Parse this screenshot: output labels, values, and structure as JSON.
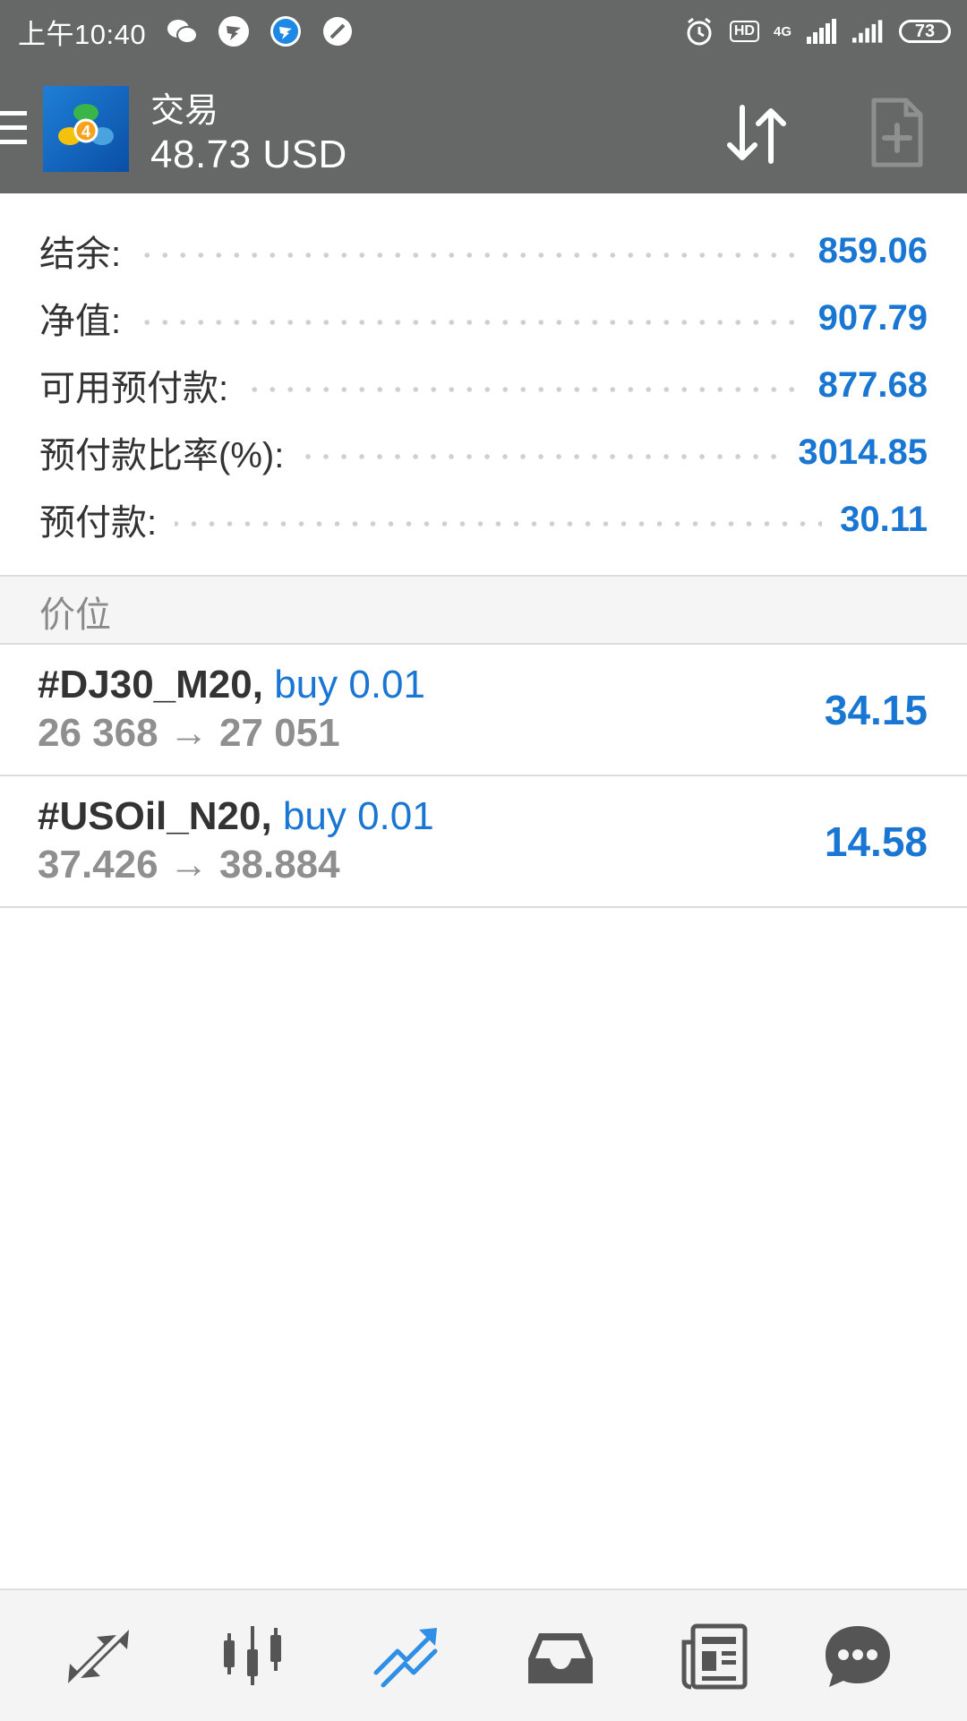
{
  "status_bar": {
    "time": "上午10:40",
    "network": "4G",
    "hd": "HD",
    "battery": "73"
  },
  "header": {
    "title": "交易",
    "balance_summary": "48.73 USD"
  },
  "account": {
    "rows": [
      {
        "label": "结余:",
        "value": "859.06"
      },
      {
        "label": "净值:",
        "value": "907.79"
      },
      {
        "label": "可用预付款:",
        "value": "877.68"
      },
      {
        "label": "预付款比率(%):",
        "value": "3014.85"
      },
      {
        "label": "预付款:",
        "value": "30.11"
      }
    ]
  },
  "positions": {
    "section_title": "价位",
    "items": [
      {
        "symbol": "#DJ30_M20,",
        "action": "buy 0.01",
        "prices": "26 368 → 27 051",
        "profit": "34.15"
      },
      {
        "symbol": "#USOil_N20,",
        "action": "buy 0.01",
        "prices": "37.426 → 38.884",
        "profit": "14.58"
      }
    ]
  },
  "bottom_nav": {
    "items": [
      {
        "icon": "quotes-arrows-icon"
      },
      {
        "icon": "chart-candles-icon"
      },
      {
        "icon": "trade-icon",
        "active": true
      },
      {
        "icon": "history-inbox-icon"
      },
      {
        "icon": "news-icon"
      },
      {
        "icon": "chat-icon"
      }
    ]
  },
  "colors": {
    "appbar": "#656867",
    "accent": "#1976d2",
    "muted": "#8f8f8f",
    "active_nav": "#2f8ee5",
    "nav_icon": "#555555"
  }
}
